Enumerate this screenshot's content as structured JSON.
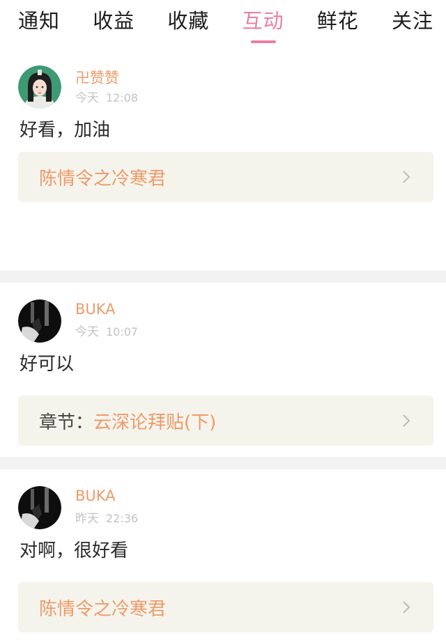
{
  "tabs": [
    {
      "label": "通知"
    },
    {
      "label": "收益"
    },
    {
      "label": "收藏"
    },
    {
      "label": "互动",
      "active": true
    },
    {
      "label": "鲜花"
    },
    {
      "label": "关注"
    }
  ],
  "comments": [
    {
      "user": "卍赞赞",
      "day": "今天",
      "clock": "12:08",
      "text": "好看，加油",
      "ref_prefix": "",
      "ref_title": "陈情令之冷寒君"
    },
    {
      "user": "BUKA",
      "day": "今天",
      "clock": "10:07",
      "text": "好可以",
      "ref_prefix": "章节：",
      "ref_title": "云深论拜贴(下)"
    },
    {
      "user": "BUKA",
      "day": "昨天",
      "clock": "22:36",
      "text": "对啊，很好看",
      "ref_prefix": "",
      "ref_title": "陈情令之冷寒君"
    }
  ],
  "colors": {
    "accent": "#ea7fa3",
    "username": "#ee9a68",
    "ref_bg": "#f4f4ec",
    "divider": "#f2f2f2"
  }
}
